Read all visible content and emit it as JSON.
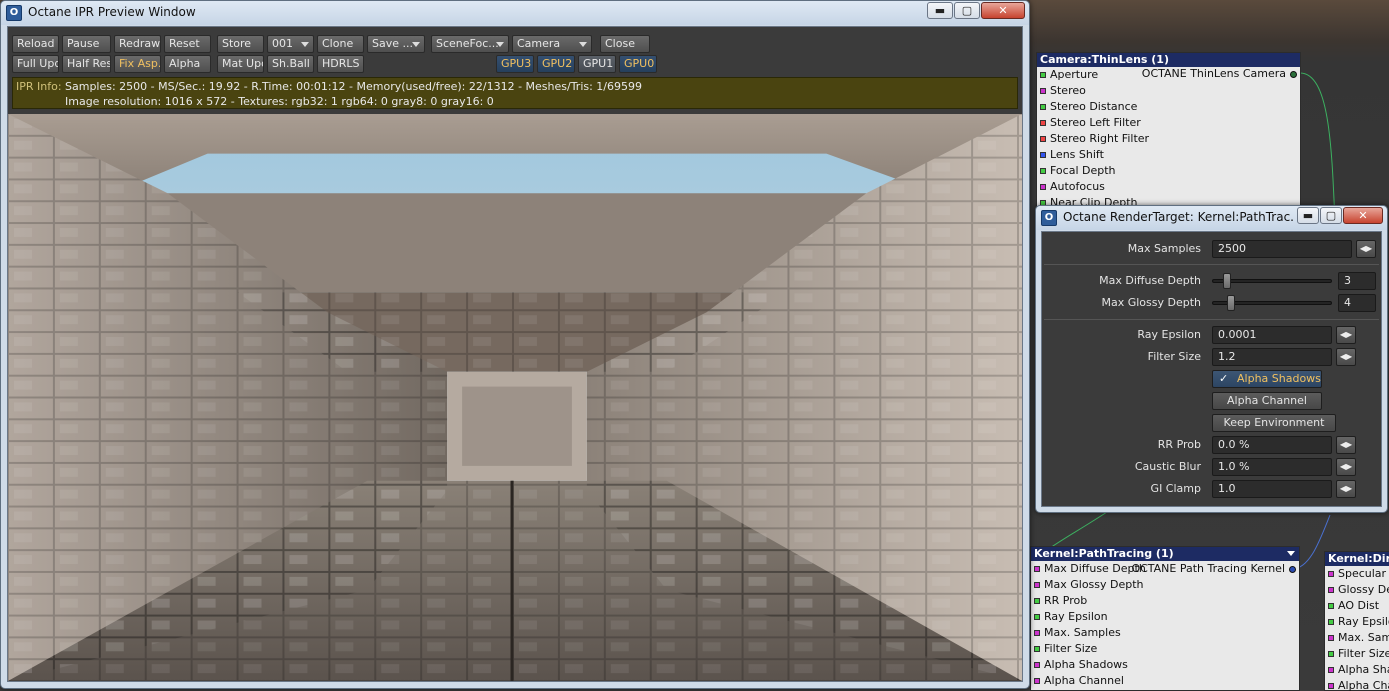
{
  "ipr_window": {
    "title": "Octane IPR Preview Window",
    "controls": {
      "minimize": "▬",
      "maximize": "▢",
      "close": "✕"
    },
    "toolbar_row1": [
      {
        "label": "Reload"
      },
      {
        "label": "Pause"
      },
      {
        "label": "Redraw"
      },
      {
        "label": "Reset"
      },
      {
        "label": "Store"
      },
      {
        "label": "001"
      },
      {
        "label": "Clone"
      },
      {
        "label": "Save ..."
      },
      {
        "label": "SceneFoc..."
      },
      {
        "label": "Camera"
      },
      {
        "label": "Close"
      }
    ],
    "toolbar_row2": [
      {
        "label": "Full Upd."
      },
      {
        "label": "Half Res"
      },
      {
        "label": "Fix Asp."
      },
      {
        "label": "Alpha"
      },
      {
        "label": "Mat Upd"
      },
      {
        "label": "Sh.Ball"
      },
      {
        "label": "HDRLS"
      }
    ],
    "gpus": [
      "GPU3",
      "GPU2",
      "GPU1",
      "GPU0"
    ],
    "info": {
      "label": "IPR Info:",
      "line1": "Samples: 2500  -  MS/Sec.: 19.92  -  R.Time: 00:01:12 - Memory(used/free): 22/1312  -  Meshes/Tris: 1/69599",
      "line2": "Image resolution: 1016 x 572 - Textures:  rgb32: 1   rgb64: 0   gray8: 0   gray16: 0"
    }
  },
  "camera_node": {
    "title": "Camera:ThinLens (1)",
    "output_label": "OCTANE ThinLens Camera",
    "pins": [
      {
        "label": "Aperture",
        "color": "#44cc44"
      },
      {
        "label": "Stereo",
        "color": "#cc33cc"
      },
      {
        "label": "Stereo Distance",
        "color": "#44cc44"
      },
      {
        "label": "Stereo Left Filter",
        "color": "#ee4444"
      },
      {
        "label": "Stereo Right Filter",
        "color": "#ee4444"
      },
      {
        "label": "Lens Shift",
        "color": "#3355ee"
      },
      {
        "label": "Focal Depth",
        "color": "#44cc44"
      },
      {
        "label": "Autofocus",
        "color": "#cc33cc"
      },
      {
        "label": "Near Clip Depth",
        "color": "#44cc44"
      }
    ]
  },
  "kernel_node": {
    "title": "Kernel:PathTracing (1)",
    "output_label": "OCTANE Path Tracing Kernel",
    "pins": [
      {
        "label": "Max Diffuse Depth",
        "color": "#cc33cc"
      },
      {
        "label": "Max Glossy Depth",
        "color": "#cc33cc"
      },
      {
        "label": "RR Prob",
        "color": "#44cc44"
      },
      {
        "label": "Ray Epsilon",
        "color": "#44cc44"
      },
      {
        "label": "Max. Samples",
        "color": "#cc33cc"
      },
      {
        "label": "Filter Size",
        "color": "#44cc44"
      },
      {
        "label": "Alpha Shadows",
        "color": "#cc33cc"
      },
      {
        "label": "Alpha Channel",
        "color": "#cc33cc"
      }
    ]
  },
  "direct_node": {
    "title": "Kernel:Direct",
    "pins": [
      {
        "label": "Specular D",
        "color": "#cc33cc"
      },
      {
        "label": "Glossy Dep",
        "color": "#cc33cc"
      },
      {
        "label": "AO Dist",
        "color": "#44cc44"
      },
      {
        "label": "Ray Epsilo",
        "color": "#44cc44"
      },
      {
        "label": "Max. Samp",
        "color": "#cc33cc"
      },
      {
        "label": "Filter Size",
        "color": "#44cc44"
      },
      {
        "label": "Alpha Shad",
        "color": "#cc33cc"
      },
      {
        "label": "Alpha Chan",
        "color": "#cc33cc"
      }
    ]
  },
  "render_target": {
    "title": "Octane RenderTarget: Kernel:PathTrac...",
    "controls": {
      "minimize": "▬",
      "maximize": "▢",
      "close": "✕"
    },
    "max_samples": {
      "label": "Max Samples",
      "value": "2500"
    },
    "max_diffuse": {
      "label": "Max Diffuse Depth",
      "value": "3",
      "level": 0.1
    },
    "max_glossy": {
      "label": "Max Glossy Depth",
      "value": "4",
      "level": 0.13
    },
    "ray_epsilon": {
      "label": "Ray Epsilon",
      "value": "0.0001"
    },
    "filter_size": {
      "label": "Filter Size",
      "value": "1.2"
    },
    "alpha_shadows": {
      "label": "Alpha Shadows",
      "checked": true,
      "mark": "✓"
    },
    "alpha_channel": {
      "label": "Alpha Channel"
    },
    "keep_env": {
      "label": "Keep Environment"
    },
    "rr_prob": {
      "label": "RR Prob",
      "value": "0.0 %"
    },
    "caustic_blur": {
      "label": "Caustic Blur",
      "value": "1.0 %"
    },
    "gi_clamp": {
      "label": "GI Clamp",
      "value": "1.0"
    },
    "spin_glyph": "◀▶"
  }
}
